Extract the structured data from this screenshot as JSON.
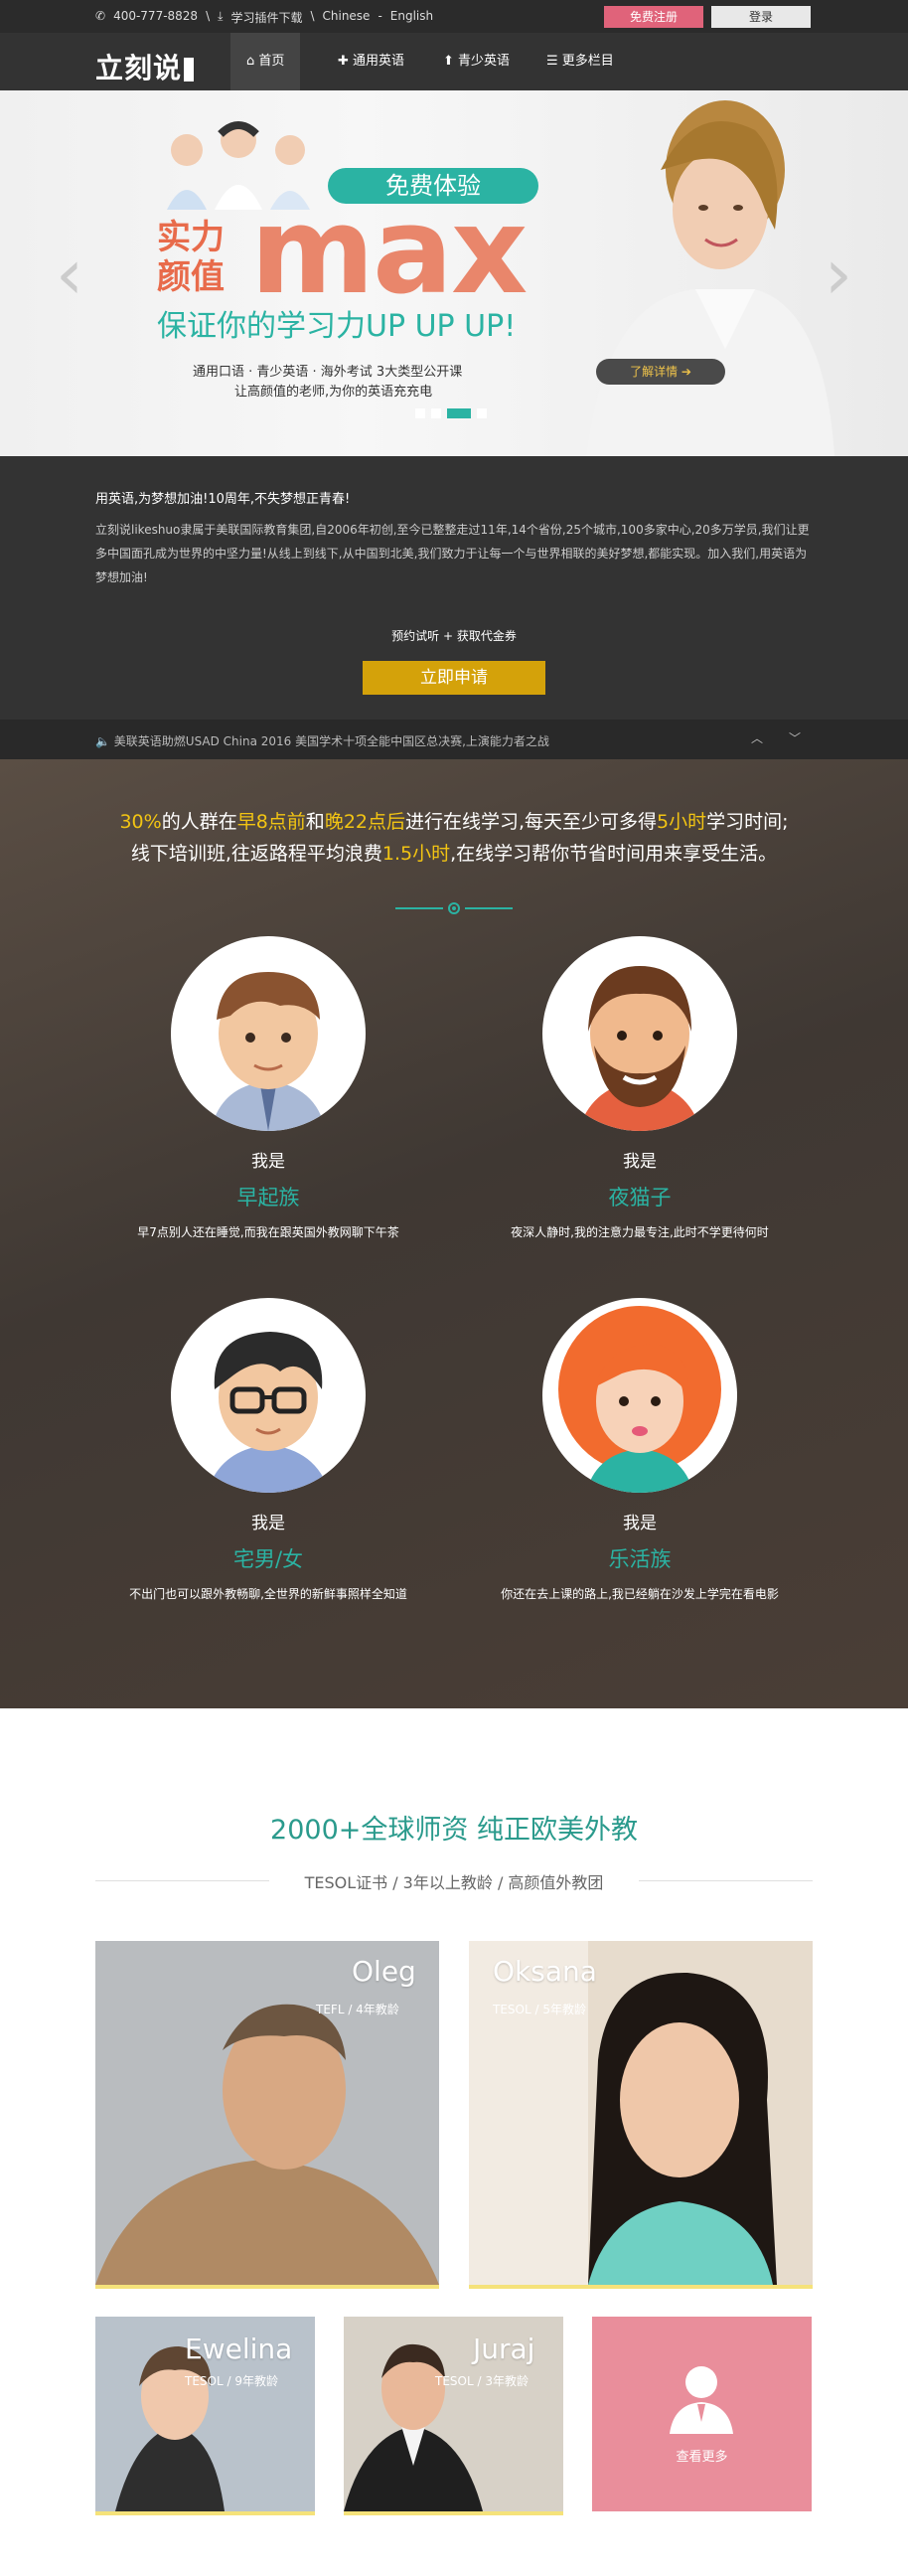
{
  "topbar": {
    "phone": "400-777-8828",
    "sep1": "\\",
    "download": "学习插件下载",
    "sep2": "\\",
    "lang_cn": "Chinese",
    "lang_sep": "-",
    "lang_en": "English",
    "register": "免费注册",
    "login": "登录"
  },
  "nav": {
    "logo": "立刻说",
    "items": [
      {
        "label": "首页",
        "icon": "home-icon"
      },
      {
        "label": "通用英语",
        "icon": "puzzle-icon"
      },
      {
        "label": "青少英语",
        "icon": "pin-icon"
      },
      {
        "label": "更多栏目",
        "icon": "menu-icon"
      }
    ]
  },
  "hero": {
    "badge": "免费体验",
    "line_cn": "实力\n颜值",
    "max": "max",
    "slogan": "保证你的学习力UP UP UP!",
    "sub1": "通用口语 · 青少英语 · 海外考试  3大类型公开课",
    "sub2": "让高颜值的老师,为你的英语充充电",
    "detail": "了解详情 ➔",
    "arrow_left": "‹",
    "arrow_right": "›"
  },
  "about": {
    "heading": "用英语,为梦想加油!10周年,不失梦想正青春!",
    "body": "立刻说likeshuo隶属于美联国际教育集团,自2006年初创,至今已整整走过11年,14个省份,25个城市,100多家中心,20多万学员,我们让更多中国面孔成为世界的中坚力量!从线上到线下,从中国到北美,我们致力于让每一个与世界相联的美好梦想,都能实现。加入我们,用英语为梦想加油!",
    "cta_text": "预约试听 + 获取代金券",
    "apply": "立即申请"
  },
  "ticker": {
    "text": "美联英语助燃USAD China 2016 美国学术十项全能中国区总决赛,上演能力者之战",
    "up": "︿",
    "down": "﹀"
  },
  "personas": {
    "line1_a": "30%",
    "line1_b": "的人群在",
    "line1_c": "早8点前",
    "line1_d": "和",
    "line1_e": "晚22点后",
    "line1_f": "进行在线学习,每天至少可多得",
    "line1_g": "5小时",
    "line1_h": "学习时间;",
    "line2_a": "线下培训班,往返路程平均浪费",
    "line2_b": "1.5小时",
    "line2_c": ",在线学习帮你节省时间用来享受生活。",
    "items": [
      {
        "i": "我是",
        "name": "早起族",
        "desc": "早7点别人还在睡觉,而我在跟英国外教网聊下午茶"
      },
      {
        "i": "我是",
        "name": "夜猫子",
        "desc": "夜深人静时,我的注意力最专注,此时不学更待何时"
      },
      {
        "i": "我是",
        "name": "宅男/女",
        "desc": "不出门也可以跟外教畅聊,全世界的新鲜事照样全知道"
      },
      {
        "i": "我是",
        "name": "乐活族",
        "desc": "你还在去上课的路上,我已经躺在沙发上学完在看电影"
      }
    ]
  },
  "teachers": {
    "heading": "2000+全球师资 纯正欧美外教",
    "subheading": "TESOL证书 / 3年以上教龄 / 高颜值外教团",
    "cards": [
      {
        "name": "Oleg",
        "meta": "TEFL / 4年教龄"
      },
      {
        "name": "Oksana",
        "meta": "TESOL / 5年教龄"
      },
      {
        "name": "Ewelina",
        "meta": "TESOL / 9年教龄"
      },
      {
        "name": "Juraj",
        "meta": "TESOL / 3年教龄"
      }
    ],
    "more": "查看更多"
  },
  "colors": {
    "teal": "#2bb3a3",
    "gold": "#d4a20a",
    "pink": "#e0637a",
    "highlight": "#f2c413"
  }
}
